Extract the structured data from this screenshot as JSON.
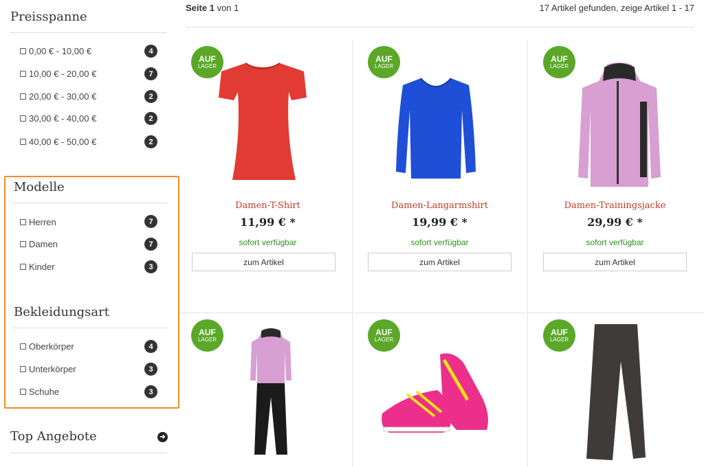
{
  "filters": {
    "price": {
      "title": "Preisspanne",
      "options": [
        {
          "label": "0,00 € - 10,00 €",
          "count": "4"
        },
        {
          "label": "10,00 € - 20,00 €",
          "count": "7"
        },
        {
          "label": "20,00 € - 30,00 €",
          "count": "2"
        },
        {
          "label": "30,00 € - 40,00 €",
          "count": "2"
        },
        {
          "label": "40,00 € - 50,00 €",
          "count": "2"
        }
      ]
    },
    "models": {
      "title": "Modelle",
      "options": [
        {
          "label": "Herren",
          "count": "7"
        },
        {
          "label": "Damen",
          "count": "7"
        },
        {
          "label": "Kinder",
          "count": "3"
        }
      ]
    },
    "clothing": {
      "title": "Bekleidungsart",
      "options": [
        {
          "label": "Oberkörper",
          "count": "4"
        },
        {
          "label": "Unterkörper",
          "count": "3"
        },
        {
          "label": "Schuhe",
          "count": "3"
        }
      ]
    },
    "top_offers": {
      "title": "Top Angebote",
      "icon": "arrow-right-circle-icon"
    }
  },
  "listing": {
    "page_label": "Seite",
    "page_current": "1",
    "page_of": "von 1",
    "result_text": "17 Artikel gefunden, zeige Artikel 1 - 17"
  },
  "badge": {
    "line1": "AUF",
    "line2": "LAGER",
    "color": "#5ba829"
  },
  "products": [
    {
      "name": "Damen-T-Shirt",
      "price": "11,99 € *",
      "availability": "sofort verfügbar",
      "button": "zum Artikel",
      "image": "red-tshirt"
    },
    {
      "name": "Damen-Langarmshirt",
      "price": "19,99 € *",
      "availability": "sofort verfügbar",
      "button": "zum Artikel",
      "image": "blue-longsleeve"
    },
    {
      "name": "Damen-Trainingsjacke",
      "price": "29,99 € *",
      "availability": "sofort verfügbar",
      "button": "zum Artikel",
      "image": "pink-jacket"
    },
    {
      "name": "",
      "image": "tracksuit"
    },
    {
      "name": "",
      "image": "pink-sneakers"
    },
    {
      "name": "",
      "image": "grey-leggings"
    }
  ],
  "colors": {
    "accent_red": "#c03a2b",
    "available_green": "#2f8f1f",
    "highlight_orange": "#f28c28"
  }
}
